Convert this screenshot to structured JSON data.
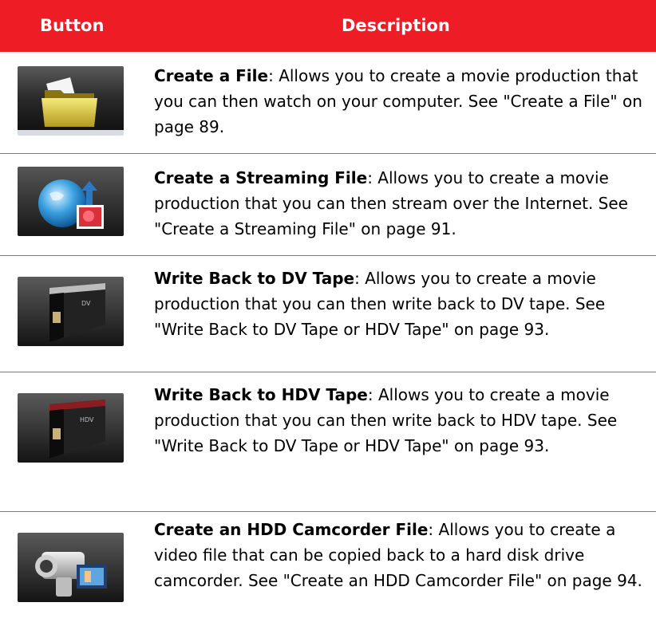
{
  "header": {
    "button_label": "Button",
    "description_label": "Description"
  },
  "rows": [
    {
      "title": "Create a File",
      "text": ": Allows you to create a movie production that you can then watch on your computer. See \"Create a File\" on page 89.",
      "icon": "folder-icon"
    },
    {
      "title": "Create a Streaming File",
      "text": ": Allows you to create a movie production that you can then stream over the Internet. See \"Create a Streaming File\" on page 91.",
      "icon": "globe-streaming-icon"
    },
    {
      "title": "Write Back to DV Tape",
      "text": ": Allows you to create a movie production that you can then write back to DV tape. See \"Write Back to DV Tape or HDV Tape\" on page 93.",
      "icon": "dv-tape-icon"
    },
    {
      "title": "Write Back to HDV Tape",
      "text": ": Allows you to create a movie production that you can then write back to HDV tape. See \"Write Back to DV Tape or HDV Tape\" on page 93.",
      "icon": "hdv-tape-icon"
    },
    {
      "title": "Create an HDD Camcorder File",
      "text": ": Allows you to create a video file that can be copied back to a hard disk drive camcorder. See \"Create an HDD Camcorder File\" on page 94.",
      "icon": "camcorder-icon"
    }
  ]
}
